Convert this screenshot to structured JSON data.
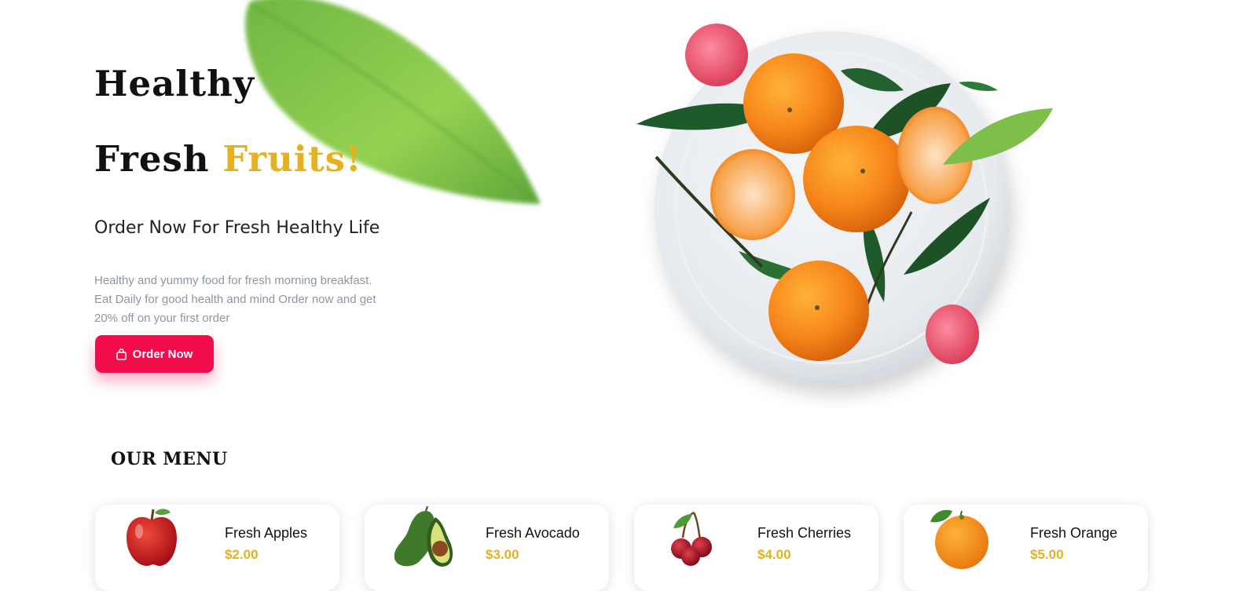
{
  "hero": {
    "title_line1": "Healthy",
    "title_line2_prefix": "Fresh ",
    "title_line2_accent": "Fruits!",
    "subtitle": "Order Now For Fresh Healthy Life",
    "description_lines": [
      "Healthy and yummy food for fresh morning breakfast.",
      "Eat Daily for good health and mind Order now and get",
      "20% off on your first order"
    ],
    "cta": {
      "label": "Order Now",
      "icon": "shopping-bag-icon"
    }
  },
  "menu": {
    "heading": "OUR MENU",
    "items": [
      {
        "name": "Fresh Apples",
        "price": "$2.00",
        "icon": "apple-image"
      },
      {
        "name": "Fresh Avocado",
        "price": "$3.00",
        "icon": "avocado-image"
      },
      {
        "name": "Fresh Cherries",
        "price": "$4.00",
        "icon": "cherries-image"
      },
      {
        "name": "Fresh Orange",
        "price": "$5.00",
        "icon": "orange-image"
      }
    ]
  },
  "colors": {
    "accent": "#e5b120",
    "cta_background": "#f20c4b",
    "muted_text": "#8d95a5"
  }
}
